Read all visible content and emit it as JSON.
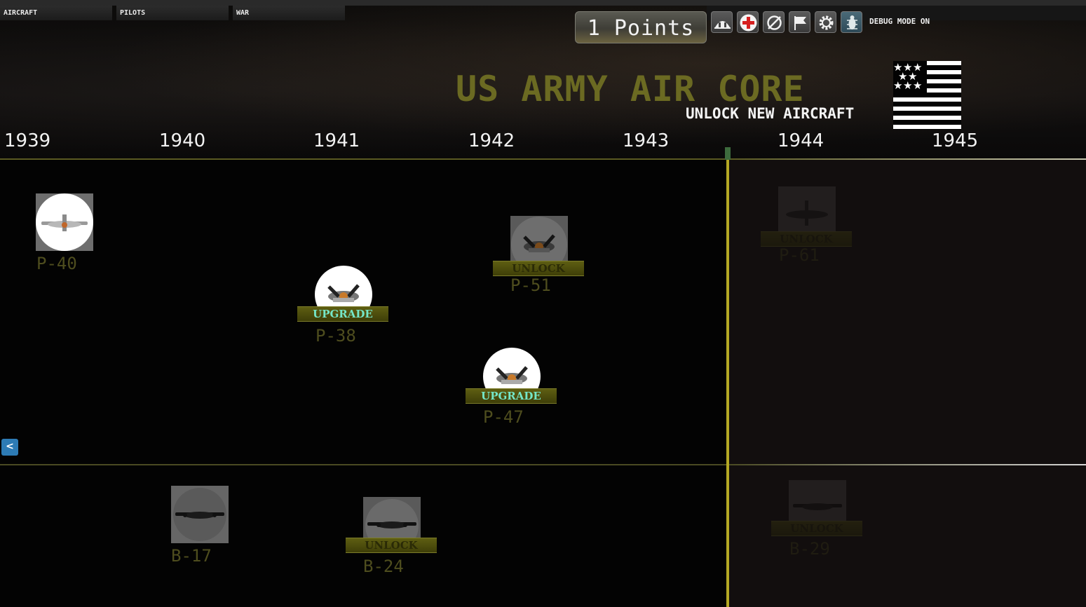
{
  "tabs": [
    {
      "label": "AIRCRAFT"
    },
    {
      "label": "PILOTS"
    },
    {
      "label": "WAR"
    }
  ],
  "points": {
    "label": "1 Points"
  },
  "toolbar": {
    "icons": [
      "hangar-icon",
      "medical-cross-icon",
      "disabled-icon",
      "flag-icon",
      "settings-gear-icon",
      "bug-icon"
    ],
    "debug_label": "DEBUG MODE ON"
  },
  "header": {
    "title": "US ARMY AIR CORE",
    "subtitle": "UNLOCK NEW AIRCRAFT"
  },
  "timeline": {
    "years": [
      "1939",
      "1940",
      "1941",
      "1942",
      "1943",
      "1944",
      "1945"
    ]
  },
  "fighters": [
    {
      "name": "P-40",
      "state": "owned"
    },
    {
      "name": "P-38",
      "state": "upgrade",
      "button": "UPGRADE"
    },
    {
      "name": "P-51",
      "state": "locked",
      "button": "UNLOCK"
    },
    {
      "name": "P-47",
      "state": "upgrade",
      "button": "UPGRADE"
    },
    {
      "name": "P-61",
      "state": "future",
      "button": "UNLOCK"
    }
  ],
  "bombers": [
    {
      "name": "B-17",
      "state": "owned"
    },
    {
      "name": "B-24",
      "state": "locked",
      "button": "UNLOCK"
    },
    {
      "name": "B-29",
      "state": "future",
      "button": "UNLOCK"
    }
  ],
  "nav": {
    "back_label": "<"
  },
  "colors": {
    "title_olive": "#6b6a22",
    "button_olive": "#5e5e12",
    "upgrade_text": "#74e6c8",
    "timeline_marker": "#b4a824",
    "back_button": "#2d7bb5"
  }
}
